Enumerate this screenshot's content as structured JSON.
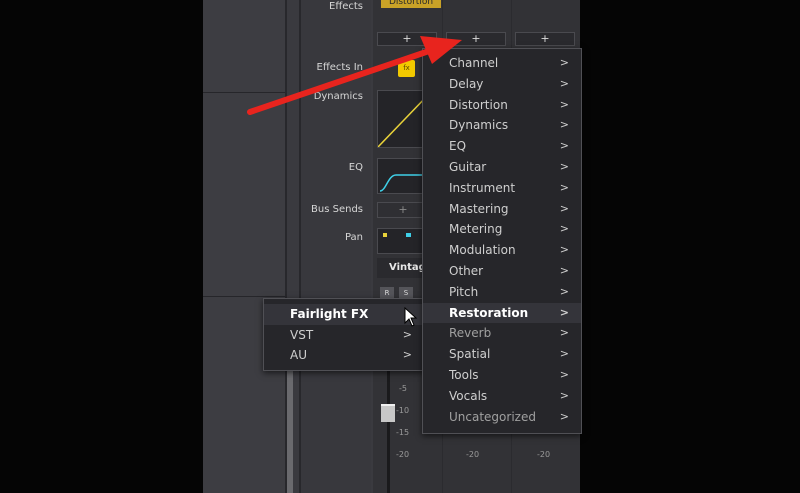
{
  "mixer": {
    "row_labels": {
      "effects": "Effects",
      "effects_in": "Effects In",
      "dynamics": "Dynamics",
      "eq": "EQ",
      "bus_sends": "Bus Sends",
      "pan": "Pan"
    },
    "effect_tag": "Distortion",
    "plus_symbol": "+",
    "fx_in_badge": "fx",
    "channel_name": "Vintag",
    "r_label": "R",
    "s_label": "S",
    "fader_scale": [
      "-5",
      "-10",
      "-15",
      "-20",
      "-20",
      "-20"
    ],
    "colors": {
      "panel_bg": "#3a3a3f",
      "fx_badge": "#f2c900",
      "effect_tag": "#c9a227",
      "eq_curve": "#3fd0e8",
      "dyn_line": "#e8d23a",
      "annotation_arrow": "#e8241e"
    }
  },
  "menu": {
    "items": [
      {
        "label": "Fairlight FX",
        "selected": true
      },
      {
        "label": "VST",
        "selected": false
      },
      {
        "label": "AU",
        "selected": false
      }
    ],
    "chevron": ">"
  },
  "submenu": {
    "items": [
      {
        "label": "Channel"
      },
      {
        "label": "Delay"
      },
      {
        "label": "Distortion"
      },
      {
        "label": "Dynamics"
      },
      {
        "label": "EQ"
      },
      {
        "label": "Guitar"
      },
      {
        "label": "Instrument"
      },
      {
        "label": "Mastering"
      },
      {
        "label": "Metering"
      },
      {
        "label": "Modulation"
      },
      {
        "label": "Other"
      },
      {
        "label": "Pitch"
      },
      {
        "label": "Restoration"
      },
      {
        "label": "Reverb"
      },
      {
        "label": "Spatial"
      },
      {
        "label": "Tools"
      },
      {
        "label": "Vocals"
      },
      {
        "label": "Uncategorized"
      }
    ],
    "selected_index": 12,
    "chevron": ">"
  },
  "icons": [
    "chevron-right-icon",
    "mouse-cursor-icon",
    "red-arrow-annotation-icon",
    "dynamics-curve-icon",
    "eq-curve-icon"
  ]
}
